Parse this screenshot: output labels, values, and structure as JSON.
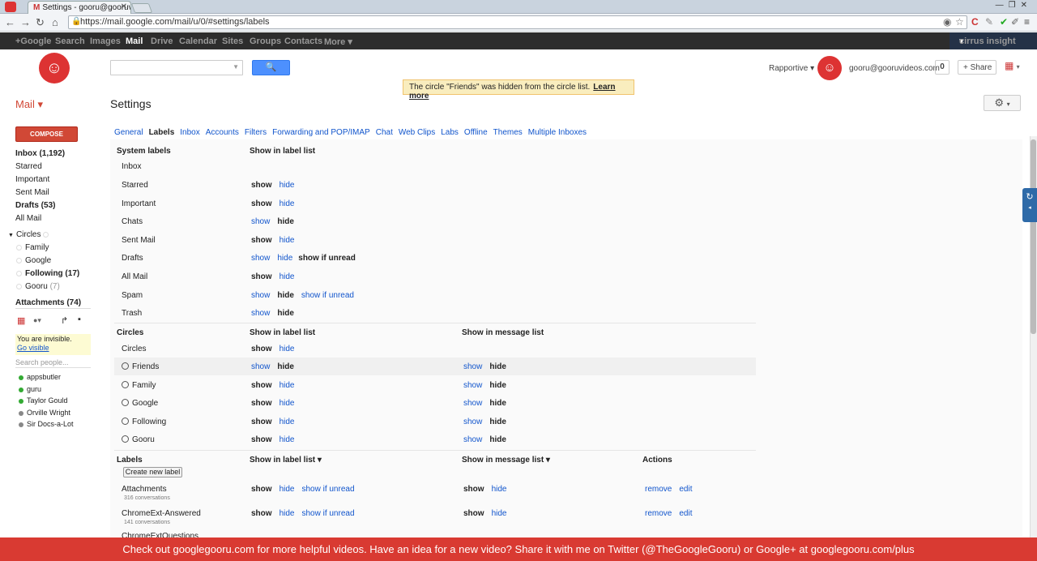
{
  "browser": {
    "tab_title": "Settings - gooru@gooruvi",
    "tab_icon": "M",
    "url": "https://mail.google.com/mail/u/0/#settings/labels"
  },
  "gbar": {
    "items": [
      "+Google",
      "Search",
      "Images",
      "Mail",
      "Drive",
      "Calendar",
      "Sites",
      "Groups",
      "Contacts",
      "More"
    ],
    "active": "Mail",
    "more_label": "More ▾",
    "cirrus": "cirrus insight"
  },
  "header": {
    "search_button": "🔍",
    "rapportive": "Rapportive ▾",
    "account_email": "gooru@gooruvideos.com",
    "notification_count": "0",
    "share_label": "Share",
    "toast_text": "The circle \"Friends\" was hidden from the circle list.",
    "toast_link": "Learn more",
    "mail_menu": "Mail ▾",
    "page_title": "Settings"
  },
  "leftnav": {
    "compose": "COMPOSE",
    "items": [
      {
        "label": "Inbox (1,192)",
        "bold": true
      },
      {
        "label": "Starred",
        "bold": false
      },
      {
        "label": "Important",
        "bold": false
      },
      {
        "label": "Sent Mail",
        "bold": false
      },
      {
        "label": "Drafts (53)",
        "bold": true
      },
      {
        "label": "All Mail",
        "bold": false
      }
    ],
    "circles_header": "Circles",
    "circles": [
      {
        "label": "Family",
        "count": ""
      },
      {
        "label": "Google",
        "count": ""
      },
      {
        "label": "Following (17)",
        "count": "",
        "bold": true
      },
      {
        "label": "Gooru",
        "count": "(7)"
      }
    ],
    "attachments": "Attachments (74)",
    "chat_status": "You are invisible.",
    "chat_link": "Go visible",
    "search_people": "Search people...",
    "contacts": [
      "appsbutler",
      "guru",
      "Taylor Gould",
      "Orville Wright",
      "Sir Docs-a-Lot"
    ]
  },
  "settings_tabs": [
    "General",
    "Labels",
    "Inbox",
    "Accounts",
    "Filters",
    "Forwarding and POP/IMAP",
    "Chat",
    "Web Clips",
    "Labs",
    "Offline",
    "Themes",
    "Multiple Inboxes"
  ],
  "settings_active_tab": "Labels",
  "system_labels": {
    "header": "System labels",
    "col_header": "Show in label list",
    "rows": [
      {
        "name": "Inbox"
      },
      {
        "name": "Starred"
      },
      {
        "name": "Important"
      },
      {
        "name": "Chats"
      },
      {
        "name": "Sent Mail"
      },
      {
        "name": "Drafts"
      },
      {
        "name": "All Mail"
      },
      {
        "name": "Spam"
      },
      {
        "name": "Trash"
      }
    ]
  },
  "circles_section": {
    "header": "Circles",
    "col_label_list": "Show in label list",
    "col_message_list": "Show in message list",
    "rows": [
      "Circles",
      "Friends",
      "Family",
      "Google",
      "Following",
      "Gooru"
    ]
  },
  "labels_section": {
    "header": "Labels",
    "col_label_list": "Show in label list ▾",
    "col_message_list": "Show in message list ▾",
    "col_actions": "Actions",
    "create_button": "Create new label",
    "rows": [
      {
        "name": "Attachments",
        "count": "316 conversations"
      },
      {
        "name": "ChromeExt-Answered",
        "count": "141 conversations"
      },
      {
        "name": "ChromeExtQuestions",
        "count": ""
      }
    ]
  },
  "words": {
    "show": "show",
    "hide": "hide",
    "show_if_unread": "show if unread",
    "remove": "remove",
    "edit": "edit"
  },
  "banner": "Check out googlegooru.com for more helpful videos. Have an idea for a new video? Share it with me on Twitter (@TheGoogleGooru) or Google+ at googlegooru.com/plus"
}
